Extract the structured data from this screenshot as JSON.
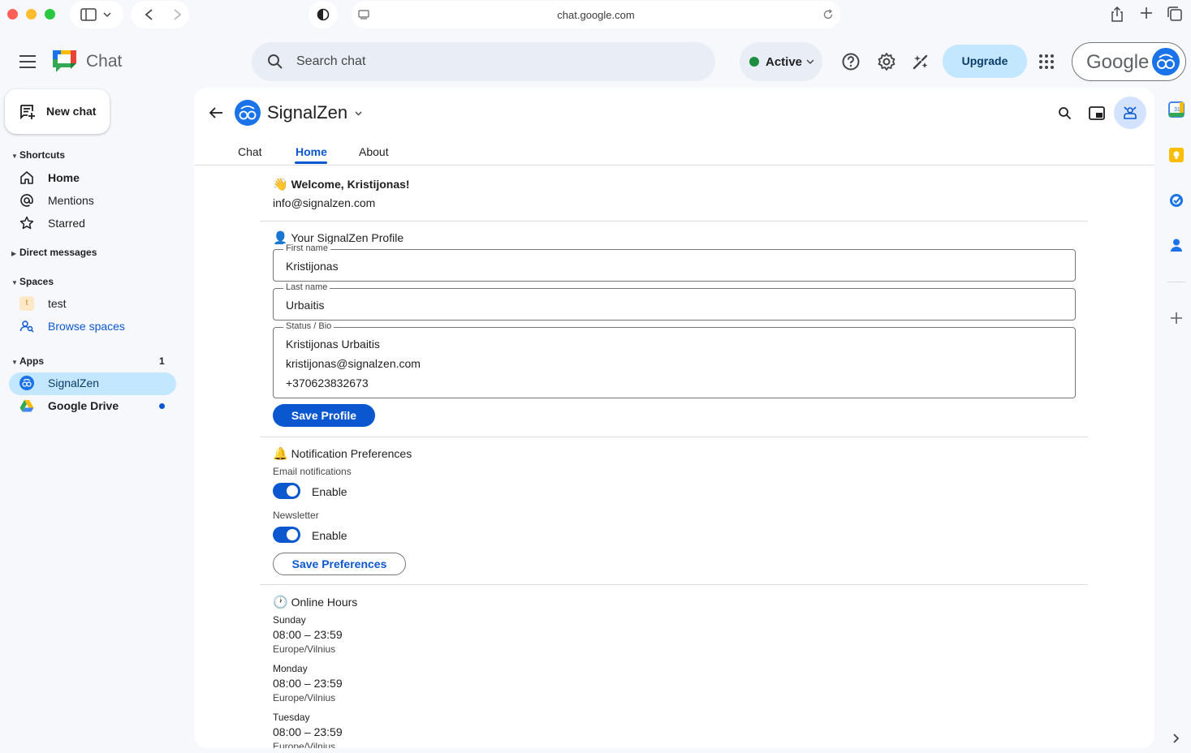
{
  "browser": {
    "url": "chat.google.com"
  },
  "header": {
    "app_title": "Chat",
    "search_placeholder": "Search chat",
    "status": "Active",
    "upgrade_label": "Upgrade",
    "account_word": "Google",
    "icons": [
      "menu-icon",
      "search-icon",
      "help-icon",
      "settings-icon",
      "gemini-icon",
      "apps-grid-icon"
    ]
  },
  "sidebar": {
    "new_chat": "New chat",
    "shortcuts_label": "Shortcuts",
    "shortcuts": [
      {
        "label": "Home",
        "icon": "home-icon",
        "bold": true
      },
      {
        "label": "Mentions",
        "icon": "at-icon"
      },
      {
        "label": "Starred",
        "icon": "star-icon"
      }
    ],
    "direct_messages_label": "Direct messages",
    "spaces_label": "Spaces",
    "spaces": [
      {
        "label": "test",
        "avatar_letter": "t"
      },
      {
        "label": "Browse spaces",
        "icon": "browse-spaces-icon"
      }
    ],
    "apps_label": "Apps",
    "apps_count": "1",
    "apps": [
      {
        "label": "SignalZen",
        "selected": true
      },
      {
        "label": "Google Drive",
        "unread": true
      }
    ]
  },
  "space": {
    "name": "SignalZen",
    "tabs": [
      "Chat",
      "Home",
      "About"
    ],
    "active_tab": "Home"
  },
  "home": {
    "welcome": "Welcome, Kristijonas!",
    "email": "info@signalzen.com",
    "profile_heading": "Your SignalZen Profile",
    "first_name_label": "First name",
    "first_name": "Kristijonas",
    "last_name_label": "Last name",
    "last_name": "Urbaitis",
    "bio_label": "Status / Bio",
    "bio_lines": [
      "Kristijonas Urbaitis",
      "kristijonas@signalzen.com",
      "+370623832673"
    ],
    "save_profile": "Save Profile",
    "notifications_heading": "Notification Preferences",
    "email_notifications_label": "Email notifications",
    "email_notifications_toggle": "Enable",
    "newsletter_label": "Newsletter",
    "newsletter_toggle": "Enable",
    "save_preferences": "Save Preferences",
    "hours_heading": "Online Hours",
    "hours": [
      {
        "day": "Sunday",
        "range": "08:00 – 23:59",
        "tz": "Europe/Vilnius"
      },
      {
        "day": "Monday",
        "range": "08:00 – 23:59",
        "tz": "Europe/Vilnius"
      },
      {
        "day": "Tuesday",
        "range": "08:00 – 23:59",
        "tz": "Europe/Vilnius"
      }
    ]
  },
  "colors": {
    "accent": "#0b57d0",
    "selected": "#c2e7ff",
    "active_dot": "#1e8e3e"
  }
}
